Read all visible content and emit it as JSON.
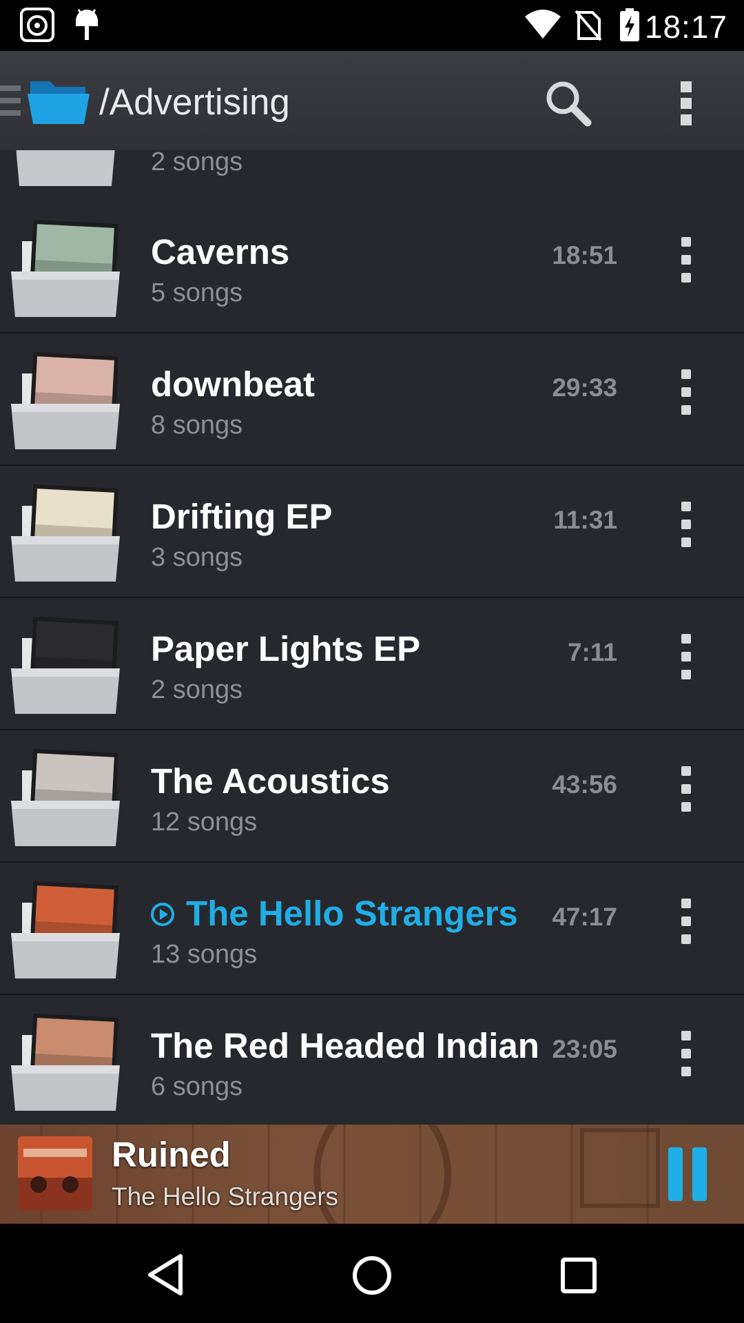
{
  "status": {
    "time": "18:17"
  },
  "toolbar": {
    "title": "/Advertising",
    "search_icon": "search-icon",
    "overflow_icon": "more-vert-icon"
  },
  "list": {
    "partial_row": {
      "subtitle": "2 songs"
    },
    "rows": [
      {
        "title": "Caverns",
        "subtitle": "5 songs",
        "duration": "18:51",
        "art_color": "#9fb8a5"
      },
      {
        "title": "downbeat",
        "subtitle": "8 songs",
        "duration": "29:33",
        "art_color": "#d9b3a8"
      },
      {
        "title": "Drifting EP",
        "subtitle": "3 songs",
        "duration": "11:31",
        "art_color": "#e8e1c9"
      },
      {
        "title": "Paper Lights EP",
        "subtitle": "2 songs",
        "duration": "7:11",
        "art_color": "#2b2b2e"
      },
      {
        "title": "The Acoustics",
        "subtitle": "12 songs",
        "duration": "43:56",
        "art_color": "#c9c4bf"
      },
      {
        "title": "The Hello Strangers",
        "subtitle": "13 songs",
        "duration": "47:17",
        "art_color": "#cf5f38",
        "playing": true
      },
      {
        "title": "The Red Headed Indian",
        "subtitle": "6 songs",
        "duration": "23:05",
        "art_color": "#c98c6e"
      }
    ]
  },
  "now_playing": {
    "title": "Ruined",
    "artist": "The Hello Strangers",
    "accent": "#1faee6"
  },
  "colors": {
    "accent": "#1faee6",
    "folder_blue": "#1e9fe0"
  }
}
